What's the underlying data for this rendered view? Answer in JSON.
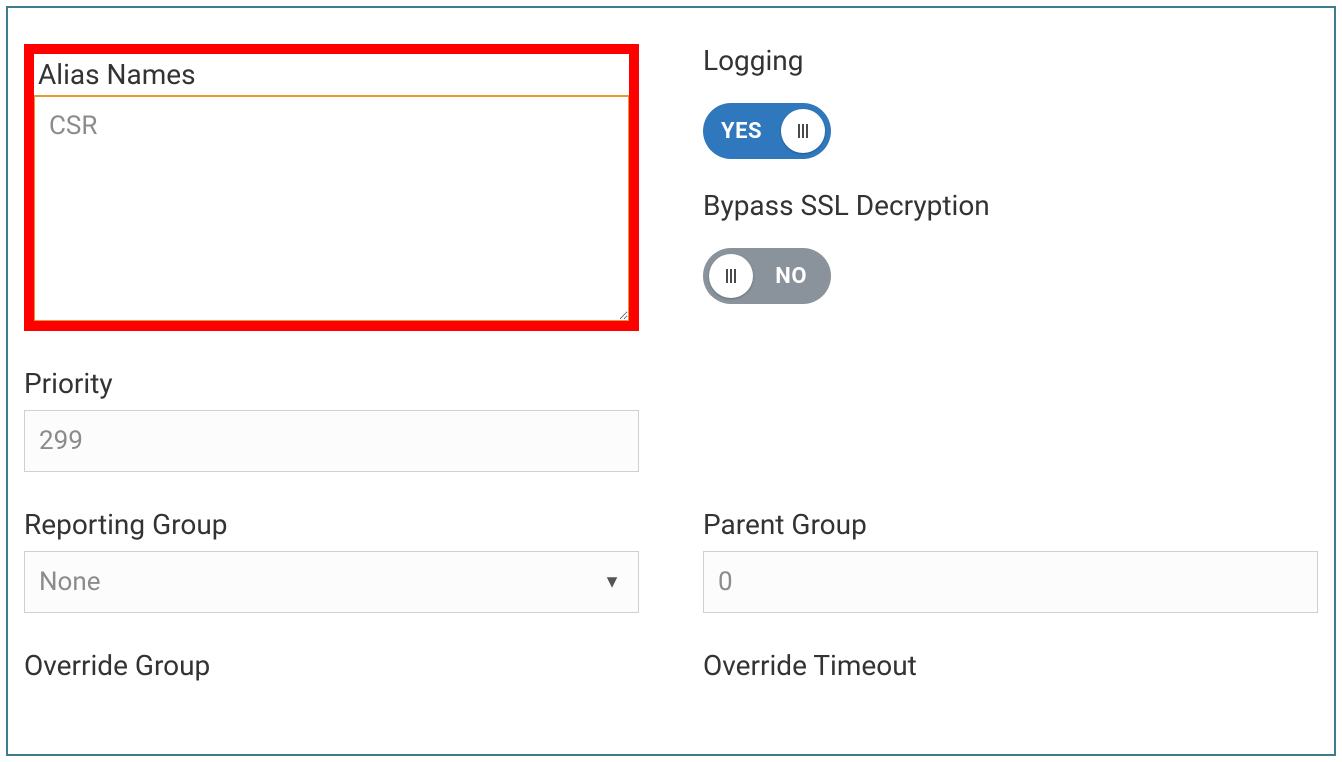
{
  "aliasNames": {
    "label": "Alias Names",
    "value": "CSR"
  },
  "logging": {
    "label": "Logging",
    "value": "YES",
    "on": true
  },
  "bypassSSL": {
    "label": "Bypass SSL Decryption",
    "value": "NO",
    "on": false
  },
  "priority": {
    "label": "Priority",
    "value": "299"
  },
  "reportingGroup": {
    "label": "Reporting Group",
    "value": "None"
  },
  "parentGroup": {
    "label": "Parent Group",
    "value": "0"
  },
  "overrideGroup": {
    "label": "Override Group"
  },
  "overrideTimeout": {
    "label": "Override Timeout"
  }
}
